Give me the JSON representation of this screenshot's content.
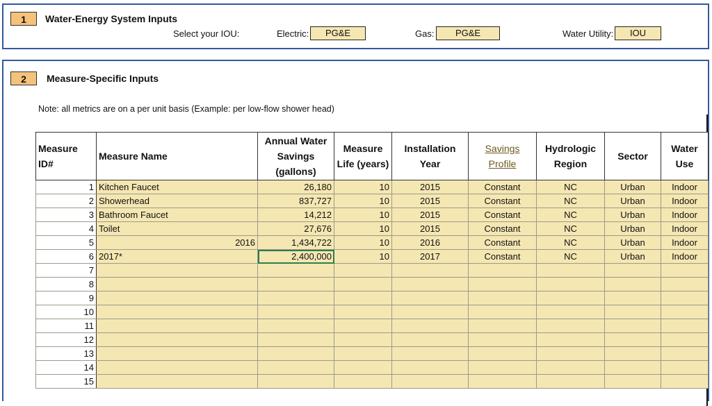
{
  "section1": {
    "number": "1",
    "title": "Water-Energy System Inputs",
    "select_label": "Select your IOU:",
    "electric_label": "Electric:",
    "electric_value": "PG&E",
    "gas_label": "Gas:",
    "gas_value": "PG&E",
    "water_label": "Water Utility:",
    "water_value": "IOU"
  },
  "section2": {
    "number": "2",
    "title": "Measure-Specific Inputs",
    "note": "Note: all metrics are on a per unit basis (Example: per low-flow shower head)"
  },
  "table": {
    "headers": {
      "id": "Measure ID#",
      "name": "Measure Name",
      "savings": "Annual Water Savings (gallons)",
      "life": "Measure Life (years)",
      "year": "Installation Year",
      "profile": "Savings Profile",
      "region": "Hydrologic Region",
      "sector": "Sector",
      "use": "Water Use"
    },
    "rows": [
      {
        "id": "1",
        "name": "Kitchen Faucet",
        "name_right": "",
        "savings": "26,180",
        "life": "10",
        "year": "2015",
        "profile": "Constant",
        "region": "NC",
        "sector": "Urban",
        "use": "Indoor"
      },
      {
        "id": "2",
        "name": "Showerhead",
        "name_right": "",
        "savings": "837,727",
        "life": "10",
        "year": "2015",
        "profile": "Constant",
        "region": "NC",
        "sector": "Urban",
        "use": "Indoor"
      },
      {
        "id": "3",
        "name": "Bathroom Faucet",
        "name_right": "",
        "savings": "14,212",
        "life": "10",
        "year": "2015",
        "profile": "Constant",
        "region": "NC",
        "sector": "Urban",
        "use": "Indoor"
      },
      {
        "id": "4",
        "name": "Toilet",
        "name_right": "",
        "savings": "27,676",
        "life": "10",
        "year": "2015",
        "profile": "Constant",
        "region": "NC",
        "sector": "Urban",
        "use": "Indoor"
      },
      {
        "id": "5",
        "name": "",
        "name_right": "2016",
        "savings": "1,434,722",
        "life": "10",
        "year": "2016",
        "profile": "Constant",
        "region": "NC",
        "sector": "Urban",
        "use": "Indoor"
      },
      {
        "id": "6",
        "name": "2017*",
        "name_right": "",
        "savings": "2,400,000",
        "life": "10",
        "year": "2017",
        "profile": "Constant",
        "region": "NC",
        "sector": "Urban",
        "use": "Indoor"
      },
      {
        "id": "7",
        "name": "",
        "name_right": "",
        "savings": "",
        "life": "",
        "year": "",
        "profile": "",
        "region": "",
        "sector": "",
        "use": ""
      },
      {
        "id": "8",
        "name": "",
        "name_right": "",
        "savings": "",
        "life": "",
        "year": "",
        "profile": "",
        "region": "",
        "sector": "",
        "use": ""
      },
      {
        "id": "9",
        "name": "",
        "name_right": "",
        "savings": "",
        "life": "",
        "year": "",
        "profile": "",
        "region": "",
        "sector": "",
        "use": ""
      },
      {
        "id": "10",
        "name": "",
        "name_right": "",
        "savings": "",
        "life": "",
        "year": "",
        "profile": "",
        "region": "",
        "sector": "",
        "use": ""
      },
      {
        "id": "11",
        "name": "",
        "name_right": "",
        "savings": "",
        "life": "",
        "year": "",
        "profile": "",
        "region": "",
        "sector": "",
        "use": ""
      },
      {
        "id": "12",
        "name": "",
        "name_right": "",
        "savings": "",
        "life": "",
        "year": "",
        "profile": "",
        "region": "",
        "sector": "",
        "use": ""
      },
      {
        "id": "13",
        "name": "",
        "name_right": "",
        "savings": "",
        "life": "",
        "year": "",
        "profile": "",
        "region": "",
        "sector": "",
        "use": ""
      },
      {
        "id": "14",
        "name": "",
        "name_right": "",
        "savings": "",
        "life": "",
        "year": "",
        "profile": "",
        "region": "",
        "sector": "",
        "use": ""
      },
      {
        "id": "15",
        "name": "",
        "name_right": "",
        "savings": "",
        "life": "",
        "year": "",
        "profile": "",
        "region": "",
        "sector": "",
        "use": ""
      }
    ]
  }
}
